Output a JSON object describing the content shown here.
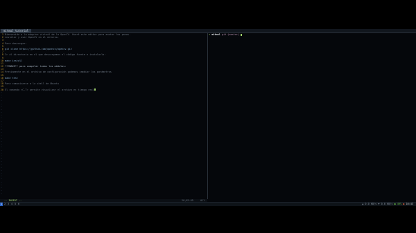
{
  "window": {
    "tab_label": "mitmul_tutorial"
  },
  "editor": {
    "lines": [
      {
        "n": "1",
        "text": "Bienvenido a la máquina virtual de la OpenCV. Usaré este editor para anotar los pasos."
      },
      {
        "n": "2",
        "text": "",
        "cont": "instalar y usar OpenCV en el entorno."
      },
      {
        "n": "3",
        "text": ""
      },
      {
        "n": "4",
        "text": "Para descargar:"
      },
      {
        "n": "5",
        "text": ""
      },
      {
        "n": "6",
        "text": "git clone https://github.com/opencv/opencv.git",
        "style": "code"
      },
      {
        "n": "7",
        "text": ""
      },
      {
        "n": "8",
        "text": "Ir al directorio en el que descargamos el código fuente e instalarlo:"
      },
      {
        "n": "9",
        "text": ""
      },
      {
        "n": "10",
        "text": "make install",
        "style": "code"
      },
      {
        "n": "11",
        "text": ""
      },
      {
        "n": "12",
        "text": "**CMAKE** para compilar todos los módulos:",
        "style": "strong"
      },
      {
        "n": "13",
        "text": ""
      },
      {
        "n": "14",
        "text": "Previamente en el archivo de configuración podemos cambiar los parámetros"
      },
      {
        "n": "15",
        "text": ""
      },
      {
        "n": "16",
        "text": "make test",
        "style": "code"
      },
      {
        "n": "17",
        "text": ""
      },
      {
        "n": "18",
        "text": "Para comunicarse a la shell de Ubuntu"
      },
      {
        "n": "19",
        "text": ""
      },
      {
        "n": "20",
        "text": "El comando <C-T> permite visualizar el archivo en tiempo real",
        "cursor": true
      }
    ],
    "tilde": "~",
    "status": {
      "mode": "-- INSERT --",
      "position": "20,62-65",
      "percent": "All"
    }
  },
  "shell": {
    "arrow": "➜",
    "dir": "mitmul",
    "branch": "git:(master)"
  },
  "taskbar": {
    "workspaces": [
      "1",
      "2",
      "3",
      "4",
      "5",
      "6"
    ],
    "active_workspace": "1",
    "tray": {
      "net": "▲ 0.0 KB/s ▼ 0.0 KB/s",
      "status_ok": "● 49%",
      "status_warn": "●",
      "clock": "10:43"
    }
  }
}
